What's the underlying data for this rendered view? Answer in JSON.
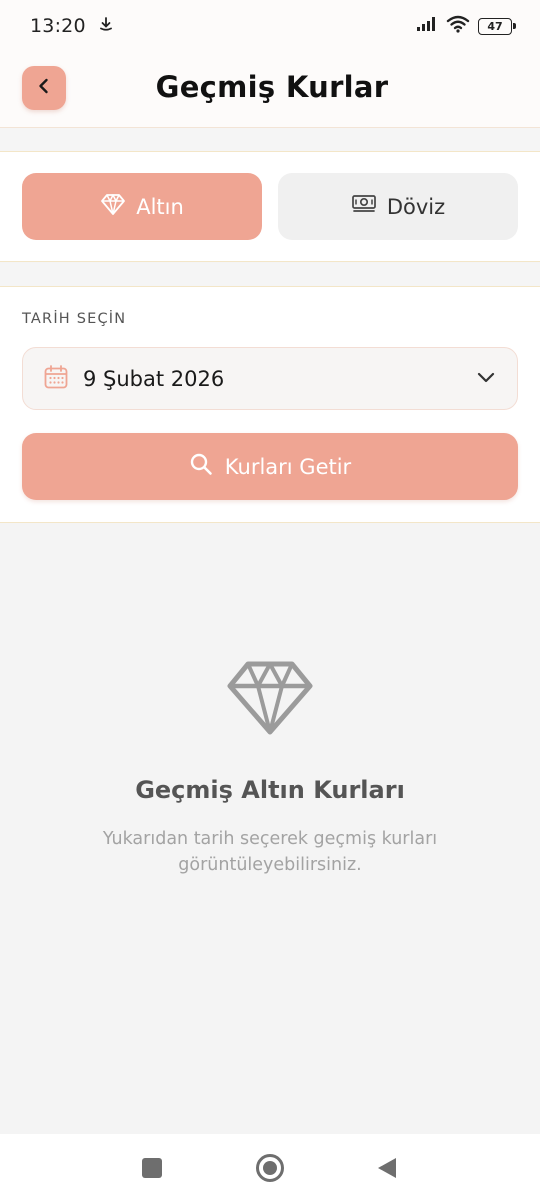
{
  "status_bar": {
    "time": "13:20",
    "battery": "47"
  },
  "header": {
    "title": "Geçmiş Kurlar"
  },
  "tabs": {
    "gold_label": "Altın",
    "currency_label": "Döviz",
    "active": "gold"
  },
  "date_picker": {
    "section_label": "TARİH SEÇİN",
    "value": "9 Şubat 2026"
  },
  "fetch_button": {
    "label": "Kurları Getir"
  },
  "empty_state": {
    "title": "Geçmiş Altın Kurları",
    "description": "Yukarıdan tarih seçerek geçmiş kurları görüntüleyebilirsiniz."
  },
  "icons": {
    "back": "chevron-left-icon",
    "gold_tab": "diamond-icon",
    "currency_tab": "banknote-icon",
    "date": "calendar-icon",
    "dropdown": "chevron-down-icon",
    "search": "search-icon",
    "empty": "diamond-icon"
  },
  "colors": {
    "accent": "#efa593",
    "accent_text": "#ffffff",
    "inactive_tab": "#f0f0f0",
    "empty_icon": "#9b9b9b"
  }
}
